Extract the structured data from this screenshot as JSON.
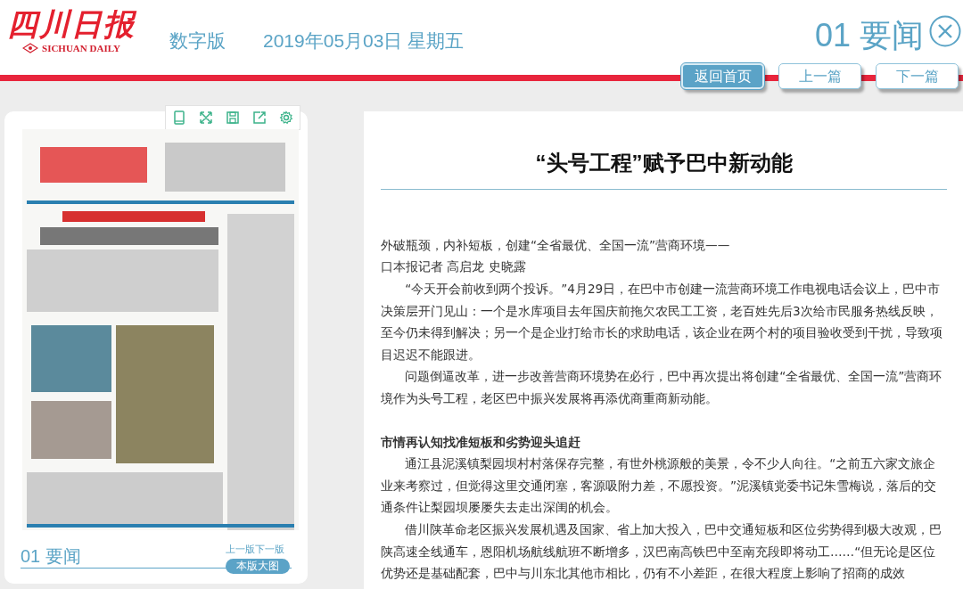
{
  "header": {
    "logo_title": "四川日报",
    "logo_subtitle": "SICHUAN DAILY",
    "edition": "数字版",
    "date": "2019年05月03日 星期五",
    "page_title": "01 要闻"
  },
  "nav_buttons": [
    {
      "label": "返回首页",
      "selected": true
    },
    {
      "label": "上一篇",
      "selected": false
    },
    {
      "label": "下一篇",
      "selected": false
    }
  ],
  "page_panel": {
    "page_label": "01 要闻",
    "prev_page": "上一版",
    "next_page": "下一版",
    "large_view": "本版大图"
  },
  "article": {
    "title": "“头号工程”赋予巴中新动能",
    "paragraphs": [
      {
        "kind": "plain",
        "text": "外破瓶颈，内补短板，创建“全省最优、全国一流”营商环境——"
      },
      {
        "kind": "plain",
        "text": "口本报记者 高启龙 史晓露"
      },
      {
        "kind": "indent",
        "text": "“今天开会前收到两个投诉。”4月29日，在巴中市创建一流营商环境工作电视电话会议上，巴中市决策层开门见山：一个是水库项目去年国庆前拖欠农民工工资，老百姓先后3次给市民服务热线反映，至今仍未得到解决；另一个是企业打给市长的求助电话，该企业在两个村的项目验收受到干扰，导致项目迟迟不能跟进。"
      },
      {
        "kind": "indent",
        "text": "问题倒逼改革，进一步改善营商环境势在必行，巴中再次提出将创建“全省最优、全国一流”营商环境作为头号工程，老区巴中振兴发展将再添优商重商新动能。"
      },
      {
        "kind": "heading",
        "text": "市情再认知找准短板和劣势迎头追赶"
      },
      {
        "kind": "indent",
        "text": "通江县泥溪镇梨园坝村村落保存完整，有世外桃源般的美景，令不少人向往。“之前五六家文旅企业来考察过，但觉得这里交通闭塞，客源吸附力差，不愿投资。”泥溪镇党委书记朱雪梅说，落后的交通条件让梨园坝屡屡失去走出深闺的机会。"
      },
      {
        "kind": "indent",
        "text": "借川陕革命老区振兴发展机遇及国家、省上加大投入，巴中交通短板和区位劣势得到极大改观，巴陕高速全线通车，恩阳机场航线航班不断增多，汉巴南高铁巴中至南充段即将动工……“但无论是区位优势还是基础配套，巴中与川东北其他市相比，仍有不小差距，在很大程度上影响了招商的成效"
      }
    ]
  }
}
